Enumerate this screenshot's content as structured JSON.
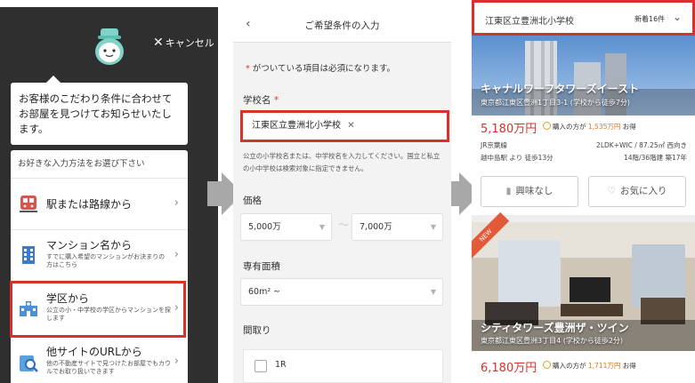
{
  "panel1": {
    "cancel_label": "キャンセル",
    "bubble_text": "お客様のこだわり条件に合わせてお部屋を見つけてお知らせいたします。",
    "choose_header": "お好きな入力方法をお選び下さい",
    "options": [
      {
        "title": "駅または路線から",
        "sub": "",
        "icon": "train-icon"
      },
      {
        "title": "マンション名から",
        "sub": "すでに購入希望のマンションがお決まりの方はこちら",
        "icon": "building-icon"
      },
      {
        "title": "学区から",
        "sub": "公立の小・中学校の学区からマンションを探します",
        "icon": "school-icon"
      },
      {
        "title": "他サイトのURLから",
        "sub": "他の不動産サイトで見つけたお部屋でもカウルでお取り扱いできます",
        "icon": "search-url-icon"
      }
    ]
  },
  "panel2": {
    "title": "ご希望条件の入力",
    "required_note": "がついている項目は必須になります。",
    "school_label": "学校名",
    "school_value": "江東区立豊洲北小学校",
    "school_note": "公立の小学校名または、中学校名を入力してください。国立と私立の小中学校は検索対象に指定できません。",
    "price_label": "価格",
    "price_min": "5,000万",
    "price_max": "7,000万",
    "tilde": "～",
    "area_label": "専有面積",
    "area_value": "60m² ~",
    "layout_label": "間取り",
    "layout_option": "1R"
  },
  "panel3": {
    "school": "江東区立豊洲北小学校",
    "count": "新着16件",
    "listing1": {
      "name": "キャナルワーフタワーズイースト",
      "address": "東京都江東区豊洲1丁目3-1 (学校から徒歩7分)",
      "price": "5,180万円",
      "savings_prefix": "購入の方が",
      "savings_amount": "1,535万円",
      "savings_suffix": "お得",
      "station": "JR京葉線",
      "walk": "越中島駅 より 徒歩13分",
      "layout": "2LDK+WIC / 87.25㎡ 西向き",
      "floor": "14階/36階建 築17年"
    },
    "buttons": {
      "not_interested": "興味なし",
      "favorite": "お気に入り"
    },
    "new_tag": "NEW",
    "listing2": {
      "name": "シティタワーズ豊洲ザ・ツイン",
      "address": "東京都江東区豊洲3丁目4 (学校から徒歩2分)",
      "price": "6,180万円",
      "savings_prefix": "購入の方が",
      "savings_amount": "1,711万円",
      "savings_suffix": "お得"
    }
  },
  "colors": {
    "highlight": "#d7312c",
    "dark_panel": "#2f2f2f",
    "arrow": "#a8a8a8",
    "price": "#d7312c",
    "savings": "#e07a1f"
  }
}
